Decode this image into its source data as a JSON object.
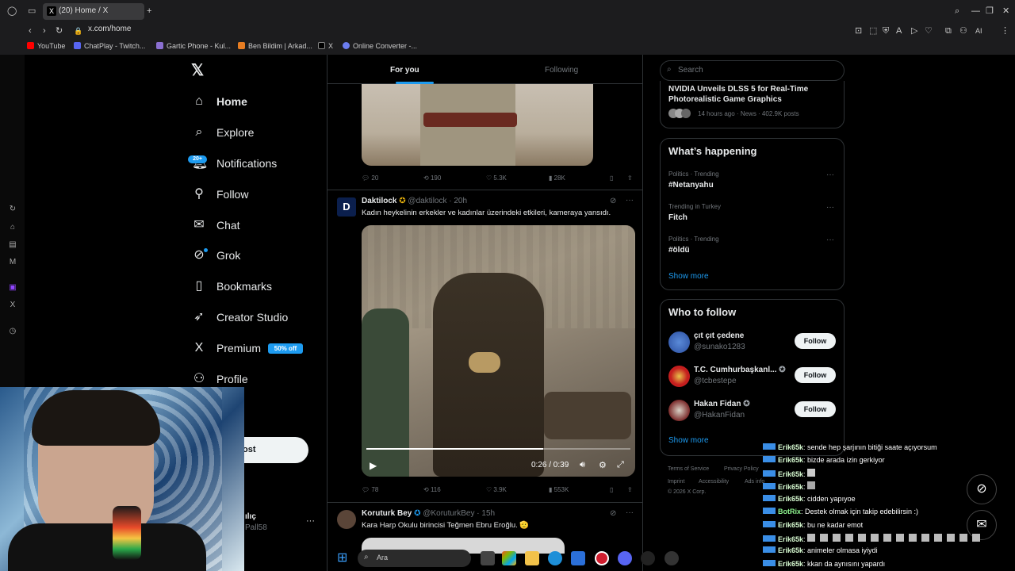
{
  "browser": {
    "tab_title": "(20) Home / X",
    "url": "x.com/home",
    "bookmarks": [
      "YouTube",
      "ChatPlay - Twitch...",
      "Gartic Phone - Kul...",
      "Ben Bildim | Arkad...",
      "X",
      "Online Converter -..."
    ]
  },
  "nav": {
    "items": [
      {
        "label": "Home",
        "icon": "home-icon"
      },
      {
        "label": "Explore",
        "icon": "search-icon"
      },
      {
        "label": "Notifications",
        "icon": "bell-icon"
      },
      {
        "label": "Follow",
        "icon": "person-plus-icon"
      },
      {
        "label": "Chat",
        "icon": "mail-icon"
      },
      {
        "label": "Grok",
        "icon": "grok-icon"
      },
      {
        "label": "Bookmarks",
        "icon": "bookmark-icon"
      },
      {
        "label": "Creator Studio",
        "icon": "rocket-icon"
      },
      {
        "label": "Premium",
        "icon": "x-icon"
      },
      {
        "label": "Profile",
        "icon": "person-icon"
      }
    ],
    "notif_badge": "20+",
    "premium_badge": "50% off",
    "post_button": "ost",
    "account_name": "ılıç",
    "account_handle": "Pall58"
  },
  "feed": {
    "tabs": [
      "For you",
      "Following"
    ],
    "post1_stats": {
      "replies": "20",
      "reposts": "190",
      "likes": "5.3K",
      "views": "28K"
    },
    "post2": {
      "name": "Daktilock",
      "handle": "@daktilock",
      "time": "· 20h",
      "text": "Kadın heykelinin erkekler ve kadınlar üzerindeki etkileri, kameraya yansıdı.",
      "video_time": "0:26 / 0:39",
      "video_progress": 0.67,
      "stats": {
        "replies": "78",
        "reposts": "116",
        "likes": "3.9K",
        "views": "553K"
      }
    },
    "post3": {
      "name": "Koruturk Bey",
      "handle": "@KoruturkBey",
      "time": "· 15h",
      "text": "Kara Harp Okulu birincisi Teğmen Ebru Eroğlu. 🫡"
    }
  },
  "right": {
    "search_placeholder": "Search",
    "top_news": {
      "title": "NVIDIA Unveils DLSS 5 for Real-Time Photorealistic Game Graphics",
      "meta": "14 hours ago · News · 402.9K posts"
    },
    "happening_title": "What’s happening",
    "trends": [
      {
        "meta": "Politics · Trending",
        "name": "#Netanyahu"
      },
      {
        "meta": "Trending in Turkey",
        "name": "Fitch"
      },
      {
        "meta": "Politics · Trending",
        "name": "#öldü"
      }
    ],
    "show_more": "Show more",
    "who_title": "Who to follow",
    "follow_suggestions": [
      {
        "name": "çıt çıt çedene",
        "handle": "@sunako1283",
        "button": "Follow"
      },
      {
        "name": "T.C. Cumhurbaşkanl...",
        "handle": "@tcbestepe",
        "button": "Follow"
      },
      {
        "name": "Hakan Fidan",
        "handle": "@HakanFidan",
        "button": "Follow"
      }
    ],
    "footer": [
      "Terms of Service",
      "Privacy Policy",
      "Imprint",
      "Accessibility",
      "Ads info",
      "© 2026 X Corp."
    ]
  },
  "chat": [
    {
      "user": "Erik65k",
      "msg": ": sende hep şarjının bitiği saate açıyorsum"
    },
    {
      "user": "Erik65k",
      "msg": ": bizde arada izin gerkiyor"
    },
    {
      "user": "Erik65k",
      "msg": ":"
    },
    {
      "user": "Erik65k",
      "msg": ":"
    },
    {
      "user": "Erik65k",
      "msg": ": cidden yapıyoe"
    },
    {
      "user": "BotRix",
      "msg": ": Destek olmak için takip edebilirsin :)"
    },
    {
      "user": "Erik65k",
      "msg": ": bu ne kadar emot"
    },
    {
      "user": "Erik65k",
      "msg": ":"
    },
    {
      "user": "Erik65k",
      "msg": ": animeler olmasa iyiydi"
    },
    {
      "user": "Erik65k",
      "msg": ": kkan da aynısını yapardı"
    }
  ],
  "taskbar": {
    "search_placeholder": "Ara"
  },
  "colors": {
    "accent": "#1d9bf0",
    "border": "#2f3336",
    "muted": "#71767b"
  }
}
